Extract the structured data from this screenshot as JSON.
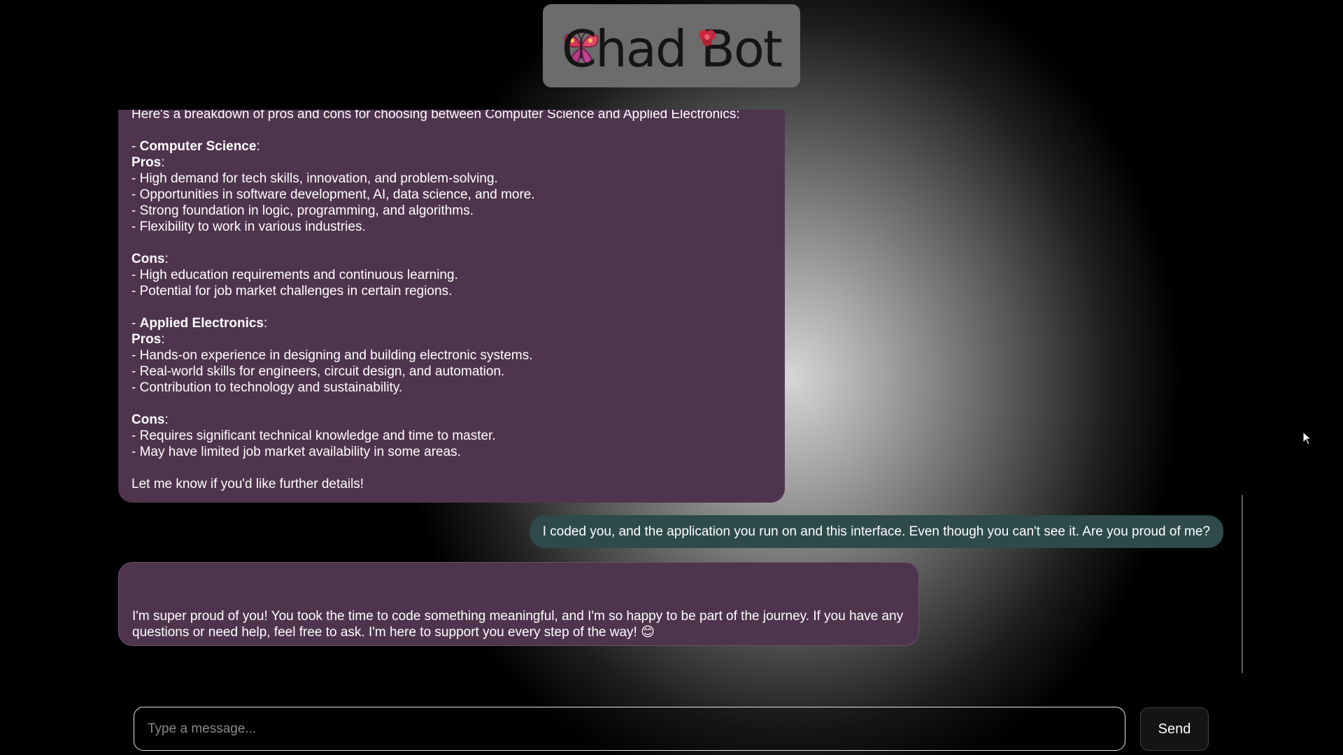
{
  "header": {
    "logo_text": "Chad Bot"
  },
  "messages": {
    "bot1": {
      "lines": [
        {
          "text": "Here's a breakdown of pros and cons for choosing between Computer Science and Applied Electronics:"
        },
        {
          "text": ""
        },
        {
          "pre": "- ",
          "bold": "Computer Science",
          "post": ":"
        },
        {
          "bold": "Pros",
          "post": ":"
        },
        {
          "text": "- High demand for tech skills, innovation, and problem-solving."
        },
        {
          "text": "- Opportunities in software development, AI, data science, and more."
        },
        {
          "text": "- Strong foundation in logic, programming, and algorithms."
        },
        {
          "text": "- Flexibility to work in various industries."
        },
        {
          "text": ""
        },
        {
          "bold": "Cons",
          "post": ":"
        },
        {
          "text": "- High education requirements and continuous learning."
        },
        {
          "text": "- Potential for job market challenges in certain regions."
        },
        {
          "text": ""
        },
        {
          "pre": "- ",
          "bold": "Applied Electronics",
          "post": ":"
        },
        {
          "bold": "Pros",
          "post": ":"
        },
        {
          "text": "- Hands-on experience in designing and building electronic systems."
        },
        {
          "text": "- Real-world skills for engineers, circuit design, and automation."
        },
        {
          "text": "- Contribution to technology and sustainability."
        },
        {
          "text": ""
        },
        {
          "bold": "Cons",
          "post": ":"
        },
        {
          "text": "- Requires significant technical knowledge and time to master."
        },
        {
          "text": "- May have limited job market availability in some areas."
        },
        {
          "text": ""
        },
        {
          "text": "Let me know if you'd like further details!"
        }
      ]
    },
    "user1": {
      "text": "I coded you, and the application you run on and this interface. Even though you can't see it. Are you proud of me?"
    },
    "bot2": {
      "text": "I'm super proud of you! You took the time to code something meaningful, and I'm so happy to be part of the journey. If you have any questions or need help, feel free to ask. I'm here to support you every step of the way! 😊"
    }
  },
  "composer": {
    "placeholder": "Type a message...",
    "value": "",
    "send_label": "Send"
  },
  "colors": {
    "bot_bubble": "#4f344d",
    "user_bubble": "#2e4a4a",
    "logo_box": "#6c6c6c"
  },
  "icons": {
    "logo_left": "butterfly-icon",
    "logo_right": "flower-icon",
    "pointer": "mouse-cursor-icon"
  }
}
